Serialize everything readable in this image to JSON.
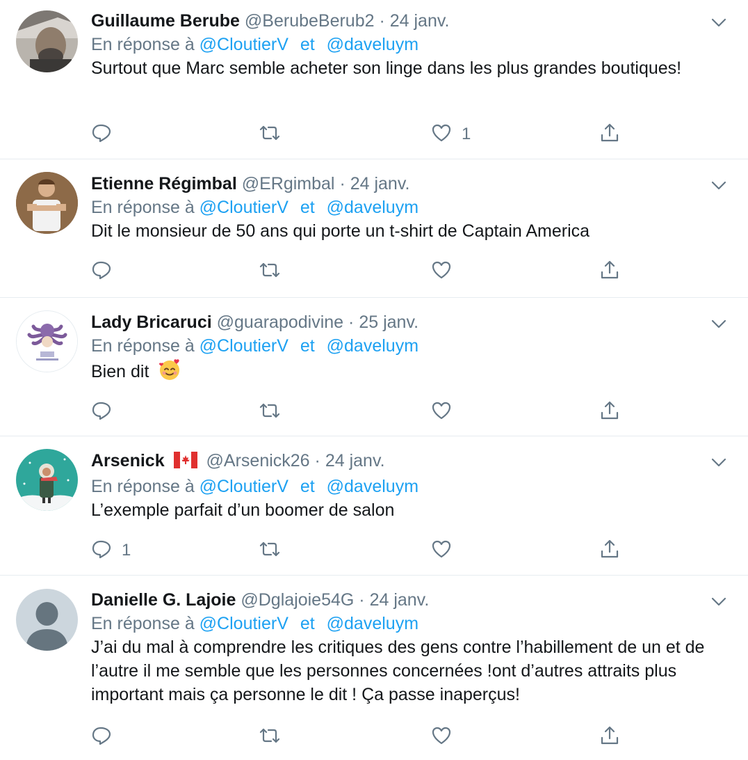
{
  "reply_prefix": "En réponse à",
  "reply_join": "et",
  "tweets": [
    {
      "name": "Guillaume Berube",
      "handle": "@BerubeBerub2",
      "date": "24 janv.",
      "mentions": [
        "@CloutierV",
        "@daveluym"
      ],
      "text": "Surtout que Marc semble acheter son linge dans les plus grandes boutiques!",
      "reply_count": "",
      "like_count": "1",
      "avatar": "photo-man-beard"
    },
    {
      "name": "Etienne Régimbal",
      "handle": "@ERgimbal",
      "date": "24 janv.",
      "mentions": [
        "@CloutierV",
        "@daveluym"
      ],
      "text": "Dit le monsieur de 50 ans qui porte un t-shirt de Captain America",
      "reply_count": "",
      "like_count": "",
      "avatar": "photo-man-tshirt"
    },
    {
      "name": "Lady Bricaruci",
      "handle": "@guarapodivine",
      "date": "25 janv.",
      "mentions": [
        "@CloutierV",
        "@daveluym"
      ],
      "text": "Bien dit",
      "emoji": "smiling-face-with-hearts",
      "reply_count": "",
      "like_count": "",
      "avatar": "octopus-illustration"
    },
    {
      "name": "Arsenick",
      "flag": "canada-flag",
      "handle": "@Arsenick26",
      "date": "24 janv.",
      "mentions": [
        "@CloutierV",
        "@daveluym"
      ],
      "text": "L’exemple parfait d’un boomer de salon",
      "reply_count": "1",
      "like_count": "",
      "avatar": "winter-character-illustration"
    },
    {
      "name": "Danielle G. Lajoie",
      "handle": "@Dglajoie54G",
      "date": "24 janv.",
      "mentions": [
        "@CloutierV",
        "@daveluym"
      ],
      "text": "J’ai du mal à comprendre les critiques des gens contre l’habillement de un et de l’autre il me semble que les personnes concernées !ont d’autres attraits plus important mais ça personne le dit ! Ça passe inaperçus!",
      "reply_count": "",
      "like_count": "",
      "avatar": "default-profile"
    }
  ],
  "colors": {
    "link": "#1da1f2",
    "secondary": "#657786",
    "primary": "#14171a",
    "divider": "#e6ecf0"
  }
}
